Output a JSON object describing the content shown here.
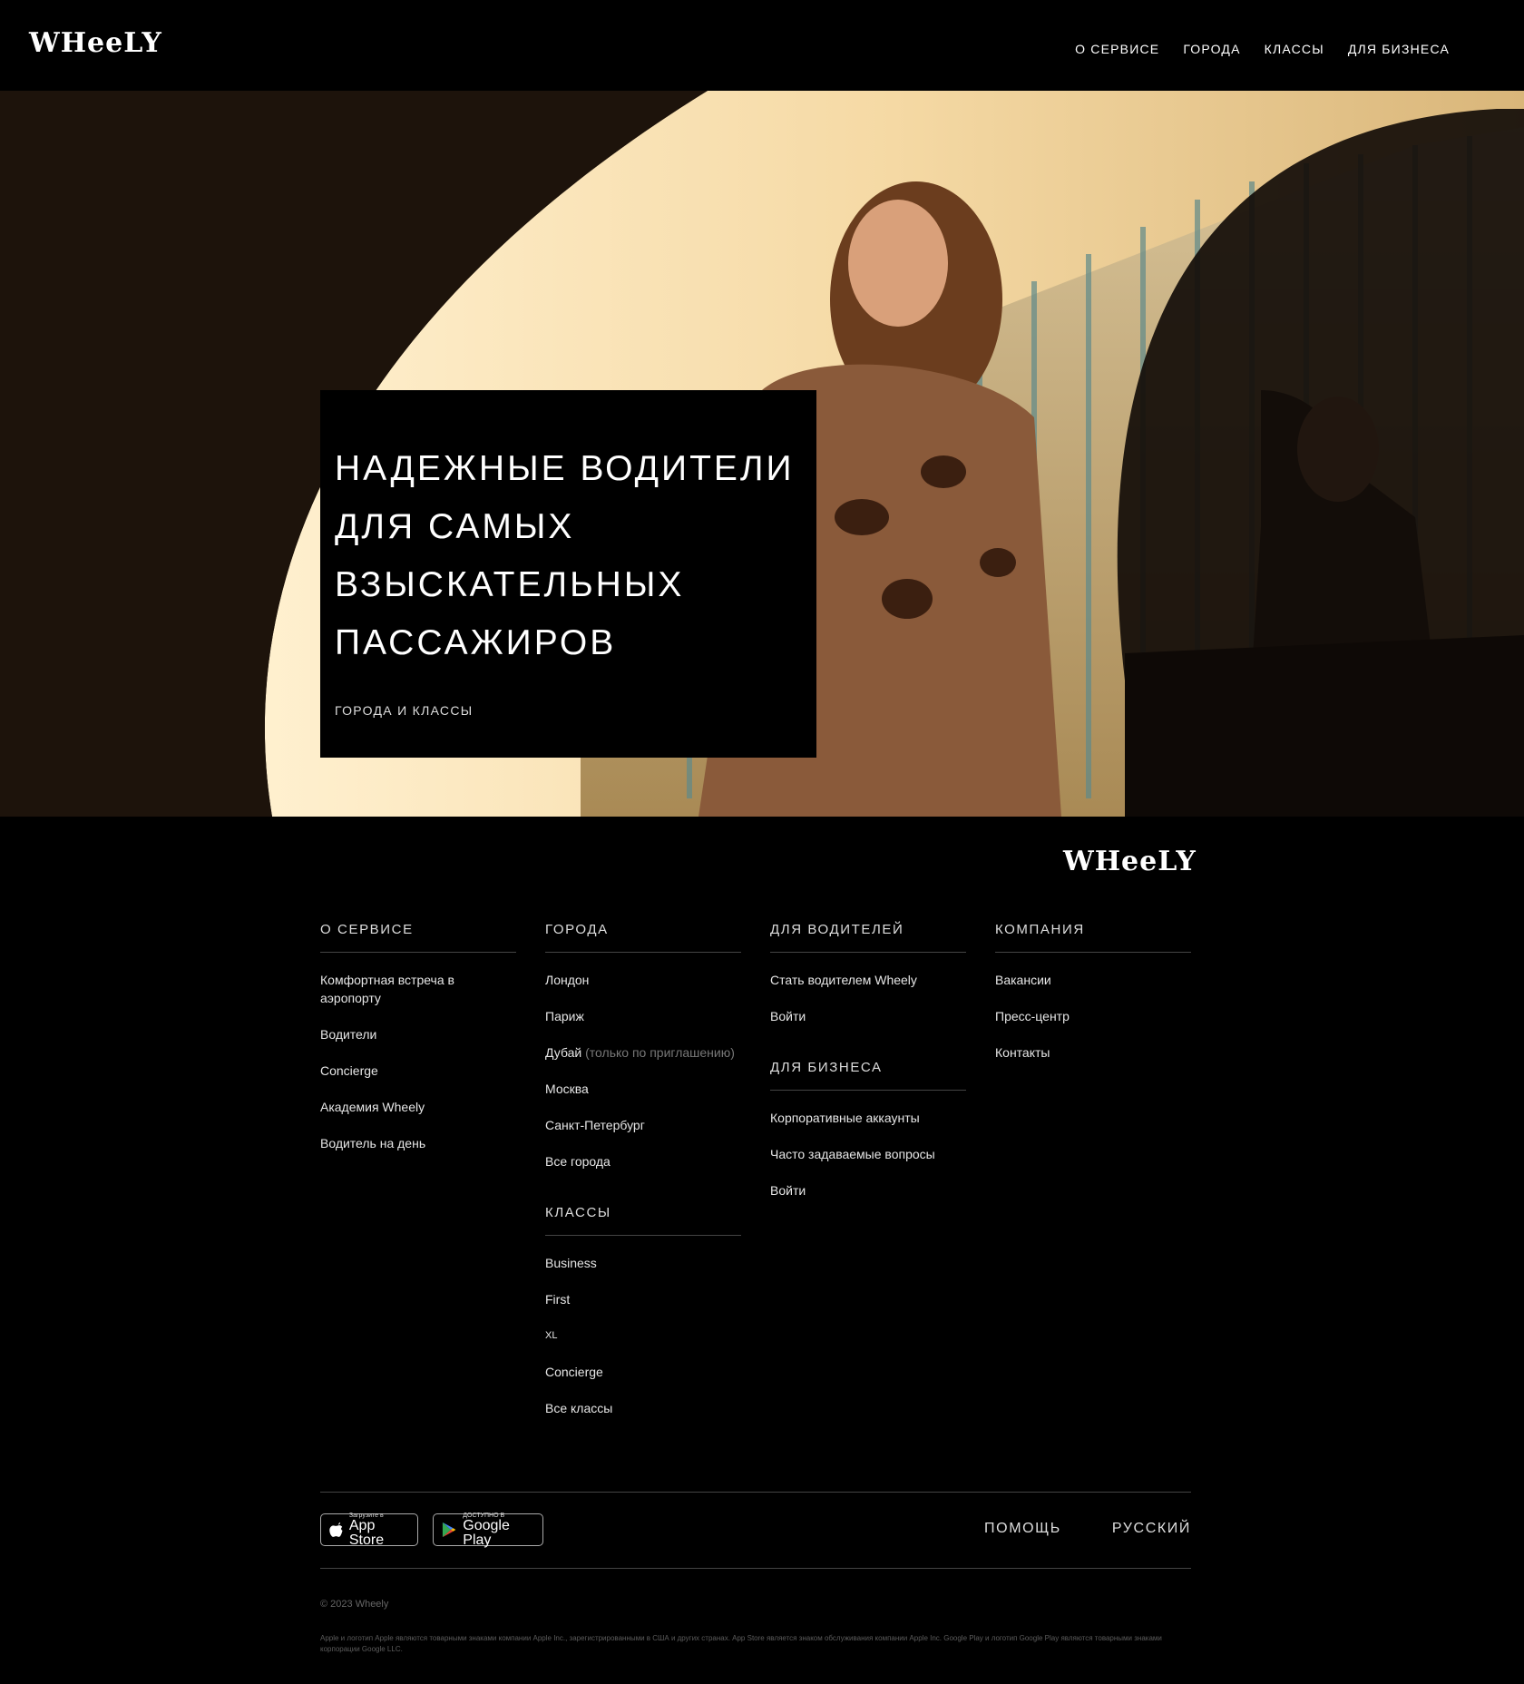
{
  "header": {
    "logo": "WHeeLY",
    "nav": [
      "О СЕРВИСЕ",
      "ГОРОДА",
      "КЛАССЫ",
      "ДЛЯ БИЗНЕСА"
    ]
  },
  "hero": {
    "title": "НАДЕЖНЫЕ ВОДИТЕЛИ ДЛЯ САМЫХ ВЗЫСКАТЕЛЬНЫХ ПАССАЖИРОВ",
    "link": "ГОРОДА И КЛАССЫ"
  },
  "footer": {
    "logo": "WHeeLY",
    "about": {
      "heading": "О СЕРВИСЕ",
      "items": [
        "Комфортная встреча в аэропорту",
        "Водители",
        "Concierge",
        "Академия Wheely",
        "Водитель на день"
      ]
    },
    "cities": {
      "heading": "ГОРОДА",
      "items": [
        "Лондон",
        "Париж",
        "Дубай",
        "Москва",
        "Санкт-Петербург",
        "Все города"
      ],
      "dubai_note": "(только по приглашению)"
    },
    "classes": {
      "heading": "КЛАССЫ",
      "items": [
        "Business",
        "First",
        "XL",
        "Concierge",
        "Все классы"
      ]
    },
    "drivers": {
      "heading": "ДЛЯ ВОДИТЕЛЕЙ",
      "items": [
        "Стать водителем Wheely",
        "Войти"
      ]
    },
    "business": {
      "heading": "ДЛЯ БИЗНЕСА",
      "items": [
        "Корпоративные аккаунты",
        "Часто задаваемые вопросы",
        "Войти"
      ]
    },
    "company": {
      "heading": "КОМПАНИЯ",
      "items": [
        "Вакансии",
        "Пресс-центр",
        "Контакты"
      ]
    },
    "appstore": {
      "small": "Загрузите в",
      "big": "App Store"
    },
    "googleplay": {
      "small": "ДОСТУПНО В",
      "big": "Google Play"
    },
    "help": "ПОМОЩЬ",
    "language": "РУССКИЙ",
    "copyright": "© 2023 Wheely",
    "legal": "Apple и логотип Apple являются товарными знаками компании Apple Inc., зарегистрированными в США и других странах. App Store является знаком обслуживания компании Apple Inc. Google Play и логотип Google Play являются товарными знаками корпорации Google LLC."
  }
}
